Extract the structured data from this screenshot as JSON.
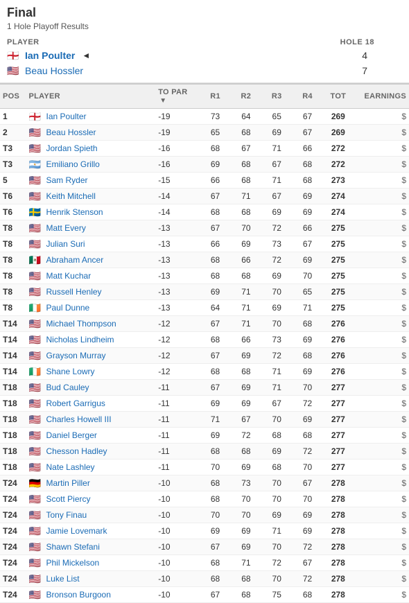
{
  "header": {
    "title": "Final",
    "playoff_label": "1 Hole Playoff Results"
  },
  "playoff": {
    "col_player": "PLAYER",
    "col_hole": "HOLE 18",
    "players": [
      {
        "name": "Ian Poulter",
        "flag": "🏴󠁧󠁢󠁥󠁮󠁧󠁿",
        "flag_text": "ENG",
        "score": "4",
        "winner": true
      },
      {
        "name": "Beau Hossler",
        "flag": "🇺🇸",
        "flag_text": "USA",
        "score": "7",
        "winner": false
      }
    ]
  },
  "table": {
    "headers": [
      "POS",
      "PLAYER",
      "TO PAR",
      "R1",
      "R2",
      "R3",
      "R4",
      "TOT",
      "EARNINGS"
    ],
    "rows": [
      {
        "pos": "1",
        "flag": "🏴󠁧󠁢󠁥󠁮󠁧󠁿",
        "name": "Ian Poulter",
        "topar": "-19",
        "r1": "73",
        "r2": "64",
        "r3": "65",
        "r4": "67",
        "tot": "269",
        "earnings": "$"
      },
      {
        "pos": "2",
        "flag": "🇺🇸",
        "name": "Beau Hossler",
        "topar": "-19",
        "r1": "65",
        "r2": "68",
        "r3": "69",
        "r4": "67",
        "tot": "269",
        "earnings": "$"
      },
      {
        "pos": "T3",
        "flag": "🇺🇸",
        "name": "Jordan Spieth",
        "topar": "-16",
        "r1": "68",
        "r2": "67",
        "r3": "71",
        "r4": "66",
        "tot": "272",
        "earnings": "$"
      },
      {
        "pos": "T3",
        "flag": "🇦🇷",
        "name": "Emiliano Grillo",
        "topar": "-16",
        "r1": "69",
        "r2": "68",
        "r3": "67",
        "r4": "68",
        "tot": "272",
        "earnings": "$"
      },
      {
        "pos": "5",
        "flag": "🇺🇸",
        "name": "Sam Ryder",
        "topar": "-15",
        "r1": "66",
        "r2": "68",
        "r3": "71",
        "r4": "68",
        "tot": "273",
        "earnings": "$"
      },
      {
        "pos": "T6",
        "flag": "🇺🇸",
        "name": "Keith Mitchell",
        "topar": "-14",
        "r1": "67",
        "r2": "71",
        "r3": "67",
        "r4": "69",
        "tot": "274",
        "earnings": "$"
      },
      {
        "pos": "T6",
        "flag": "🇸🇪",
        "name": "Henrik Stenson",
        "topar": "-14",
        "r1": "68",
        "r2": "68",
        "r3": "69",
        "r4": "69",
        "tot": "274",
        "earnings": "$"
      },
      {
        "pos": "T8",
        "flag": "🇺🇸",
        "name": "Matt Every",
        "topar": "-13",
        "r1": "67",
        "r2": "70",
        "r3": "72",
        "r4": "66",
        "tot": "275",
        "earnings": "$"
      },
      {
        "pos": "T8",
        "flag": "🇺🇸",
        "name": "Julian Suri",
        "topar": "-13",
        "r1": "66",
        "r2": "69",
        "r3": "73",
        "r4": "67",
        "tot": "275",
        "earnings": "$"
      },
      {
        "pos": "T8",
        "flag": "🇲🇽",
        "name": "Abraham Ancer",
        "topar": "-13",
        "r1": "68",
        "r2": "66",
        "r3": "72",
        "r4": "69",
        "tot": "275",
        "earnings": "$"
      },
      {
        "pos": "T8",
        "flag": "🇺🇸",
        "name": "Matt Kuchar",
        "topar": "-13",
        "r1": "68",
        "r2": "68",
        "r3": "69",
        "r4": "70",
        "tot": "275",
        "earnings": "$"
      },
      {
        "pos": "T8",
        "flag": "🇺🇸",
        "name": "Russell Henley",
        "topar": "-13",
        "r1": "69",
        "r2": "71",
        "r3": "70",
        "r4": "65",
        "tot": "275",
        "earnings": "$"
      },
      {
        "pos": "T8",
        "flag": "🇮🇪",
        "name": "Paul Dunne",
        "topar": "-13",
        "r1": "64",
        "r2": "71",
        "r3": "69",
        "r4": "71",
        "tot": "275",
        "earnings": "$"
      },
      {
        "pos": "T14",
        "flag": "🇺🇸",
        "name": "Michael Thompson",
        "topar": "-12",
        "r1": "67",
        "r2": "71",
        "r3": "70",
        "r4": "68",
        "tot": "276",
        "earnings": "$"
      },
      {
        "pos": "T14",
        "flag": "🇺🇸",
        "name": "Nicholas Lindheim",
        "topar": "-12",
        "r1": "68",
        "r2": "66",
        "r3": "73",
        "r4": "69",
        "tot": "276",
        "earnings": "$"
      },
      {
        "pos": "T14",
        "flag": "🇺🇸",
        "name": "Grayson Murray",
        "topar": "-12",
        "r1": "67",
        "r2": "69",
        "r3": "72",
        "r4": "68",
        "tot": "276",
        "earnings": "$"
      },
      {
        "pos": "T14",
        "flag": "🇮🇪",
        "name": "Shane Lowry",
        "topar": "-12",
        "r1": "68",
        "r2": "68",
        "r3": "71",
        "r4": "69",
        "tot": "276",
        "earnings": "$"
      },
      {
        "pos": "T18",
        "flag": "🇺🇸",
        "name": "Bud Cauley",
        "topar": "-11",
        "r1": "67",
        "r2": "69",
        "r3": "71",
        "r4": "70",
        "tot": "277",
        "earnings": "$"
      },
      {
        "pos": "T18",
        "flag": "🇺🇸",
        "name": "Robert Garrigus",
        "topar": "-11",
        "r1": "69",
        "r2": "69",
        "r3": "67",
        "r4": "72",
        "tot": "277",
        "earnings": "$"
      },
      {
        "pos": "T18",
        "flag": "🇺🇸",
        "name": "Charles Howell III",
        "topar": "-11",
        "r1": "71",
        "r2": "67",
        "r3": "70",
        "r4": "69",
        "tot": "277",
        "earnings": "$"
      },
      {
        "pos": "T18",
        "flag": "🇺🇸",
        "name": "Daniel Berger",
        "topar": "-11",
        "r1": "69",
        "r2": "72",
        "r3": "68",
        "r4": "68",
        "tot": "277",
        "earnings": "$"
      },
      {
        "pos": "T18",
        "flag": "🇺🇸",
        "name": "Chesson Hadley",
        "topar": "-11",
        "r1": "68",
        "r2": "68",
        "r3": "69",
        "r4": "72",
        "tot": "277",
        "earnings": "$"
      },
      {
        "pos": "T18",
        "flag": "🇺🇸",
        "name": "Nate Lashley",
        "topar": "-11",
        "r1": "70",
        "r2": "69",
        "r3": "68",
        "r4": "70",
        "tot": "277",
        "earnings": "$"
      },
      {
        "pos": "T24",
        "flag": "🇩🇪",
        "name": "Martin Piller",
        "topar": "-10",
        "r1": "68",
        "r2": "73",
        "r3": "70",
        "r4": "67",
        "tot": "278",
        "earnings": "$"
      },
      {
        "pos": "T24",
        "flag": "🇺🇸",
        "name": "Scott Piercy",
        "topar": "-10",
        "r1": "68",
        "r2": "70",
        "r3": "70",
        "r4": "70",
        "tot": "278",
        "earnings": "$"
      },
      {
        "pos": "T24",
        "flag": "🇺🇸",
        "name": "Tony Finau",
        "topar": "-10",
        "r1": "70",
        "r2": "70",
        "r3": "69",
        "r4": "69",
        "tot": "278",
        "earnings": "$"
      },
      {
        "pos": "T24",
        "flag": "🇺🇸",
        "name": "Jamie Lovemark",
        "topar": "-10",
        "r1": "69",
        "r2": "69",
        "r3": "71",
        "r4": "69",
        "tot": "278",
        "earnings": "$"
      },
      {
        "pos": "T24",
        "flag": "🇺🇸",
        "name": "Shawn Stefani",
        "topar": "-10",
        "r1": "67",
        "r2": "69",
        "r3": "70",
        "r4": "72",
        "tot": "278",
        "earnings": "$"
      },
      {
        "pos": "T24",
        "flag": "🇺🇸",
        "name": "Phil Mickelson",
        "topar": "-10",
        "r1": "68",
        "r2": "71",
        "r3": "72",
        "r4": "67",
        "tot": "278",
        "earnings": "$"
      },
      {
        "pos": "T24",
        "flag": "🇺🇸",
        "name": "Luke List",
        "topar": "-10",
        "r1": "68",
        "r2": "68",
        "r3": "70",
        "r4": "72",
        "tot": "278",
        "earnings": "$"
      },
      {
        "pos": "T24",
        "flag": "🇺🇸",
        "name": "Bronson Burgoon",
        "topar": "-10",
        "r1": "67",
        "r2": "68",
        "r3": "75",
        "r4": "68",
        "tot": "278",
        "earnings": "$"
      }
    ]
  }
}
